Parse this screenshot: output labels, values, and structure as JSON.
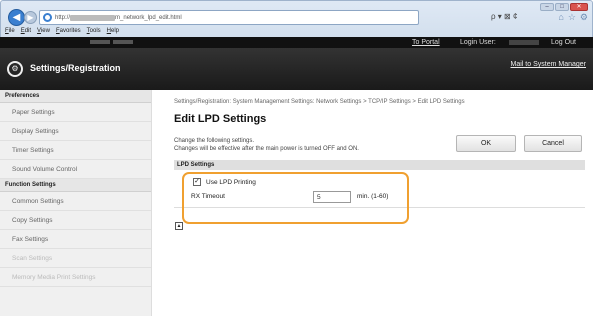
{
  "browser": {
    "url_host": "http://",
    "url_path": "m_network_lpd_edit.html",
    "search_controls": "ρ ▾ ⊠ ¢",
    "menu": [
      "File",
      "Edit",
      "View",
      "Favorites",
      "Tools",
      "Help"
    ]
  },
  "header": {
    "toportal": "To Portal",
    "login_label": "Login User:",
    "logout": "Log Out",
    "title": "Settings/Registration",
    "mail": "Mail to System Manager"
  },
  "sidebar": {
    "preferences_heading": "Preferences",
    "preferences": [
      "Paper Settings",
      "Display Settings",
      "Timer Settings",
      "Sound Volume Control"
    ],
    "function_heading": "Function Settings",
    "functions": [
      "Common Settings",
      "Copy Settings",
      "Fax Settings",
      "Scan Settings",
      "Memory Media Print Settings"
    ]
  },
  "main": {
    "breadcrumb": "Settings/Registration: System Management Settings: Network Settings > TCP/IP Settings > Edit LPD Settings",
    "title": "Edit LPD Settings",
    "msg_line1": "Change the following settings.",
    "msg_line2": "Changes will be effective after the main power is turned OFF and ON.",
    "ok": "OK",
    "cancel": "Cancel",
    "section": "LPD Settings",
    "use_lpd": "Use LPD Printing",
    "use_lpd_checked": true,
    "rx_label": "RX Timeout",
    "rx_value": "5",
    "rx_unit": "min. (1-60)"
  }
}
